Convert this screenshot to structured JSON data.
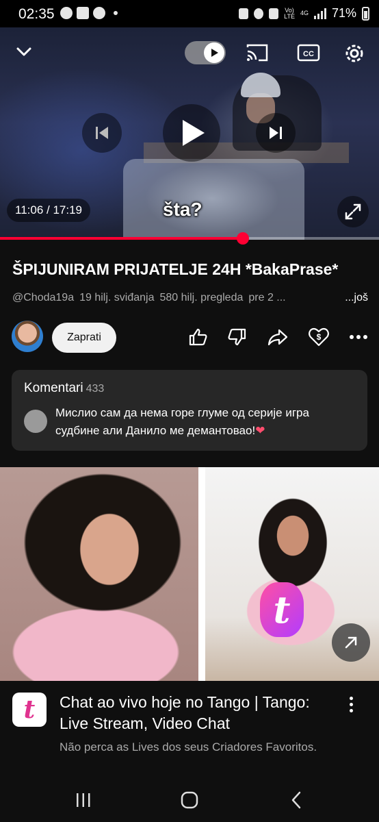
{
  "status_bar": {
    "time": "02:35",
    "network_top": "Vo)",
    "network_bottom": "LTE",
    "network_type": "4G",
    "battery": "71%"
  },
  "player": {
    "time_display": "11:06 / 17:19",
    "caption": "šta?",
    "progress": 0.64,
    "accent_color": "#ff0033",
    "icons": [
      "chevron-down-icon",
      "autoplay-toggle",
      "cast-icon",
      "captions-icon",
      "settings-icon",
      "previous-icon",
      "play-icon",
      "next-icon",
      "fullscreen-icon"
    ]
  },
  "video": {
    "title": "ŠPIJUNIRAM PRIJATELJE 24H *BakaPrase*",
    "channel": "@Choda19a",
    "likes": "19 hilj. sviđanja",
    "views": "580 hilj. pregleda",
    "age": "pre 2 ...",
    "more_label": "...još"
  },
  "actions": {
    "follow_label": "Zaprati",
    "icons": [
      "like-icon",
      "dislike-icon",
      "share-icon",
      "thanks-icon",
      "more-icon"
    ]
  },
  "comments": {
    "heading": "Komentari",
    "count": "433",
    "top_comment": "Мислио сам да нема горе глуме од серије игра судбине али Данило ме демантовао!",
    "emoji": "❤"
  },
  "ad": {
    "logo_glyph": "t",
    "title": "Chat ao vivo hoje no Tango | Tango: Live Stream, Video Chat",
    "description": "Não perca as Lives dos seus Criadores Favoritos."
  },
  "navbar": {
    "icons": [
      "recents-icon",
      "home-icon",
      "back-icon"
    ]
  }
}
